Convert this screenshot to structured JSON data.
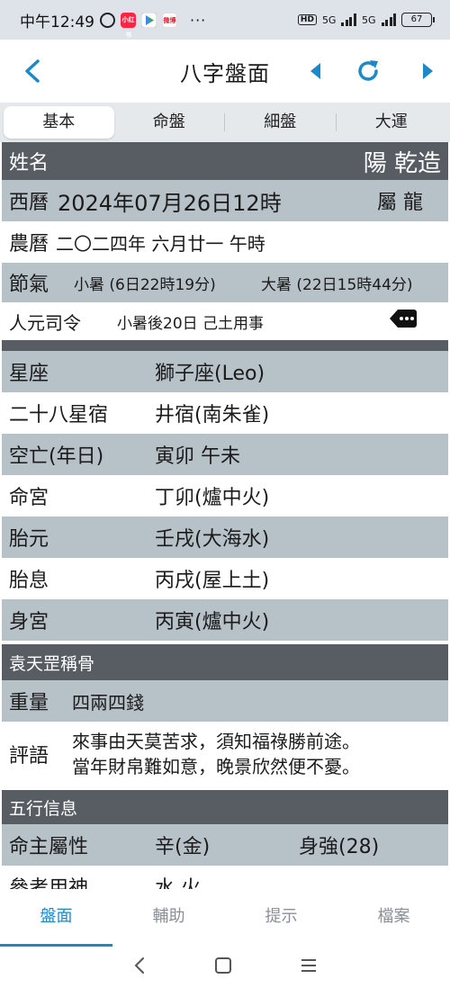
{
  "status_bar": {
    "time": "中午12:49",
    "more": "···",
    "hd": "HD",
    "network1": "5G",
    "network2": "5G",
    "battery": "67",
    "badge1": "小红书",
    "badge3": "微博"
  },
  "app_bar": {
    "title": "八字盤面"
  },
  "tabs": [
    "基本",
    "命盤",
    "細盤",
    "大運"
  ],
  "header": {
    "label": "姓名",
    "value": "陽 乾造"
  },
  "birth": {
    "solar_label": "西曆",
    "solar_value": "2024年07月26日12時",
    "zodiac": "屬 龍",
    "lunar_label": "農曆",
    "lunar_value": "二〇二四年 六月廿一 午時",
    "jieqi_label": "節氣",
    "jieqi_1": "小暑 (6日22時19分)",
    "jieqi_2": "大暑 (22日15時44分)",
    "siling_label": "人元司令",
    "siling_value": "小暑後20日 己土用事"
  },
  "info_rows": [
    {
      "label": "星座",
      "value": "獅子座(Leo)"
    },
    {
      "label": "二十八星宿",
      "value": "井宿(南朱雀)"
    },
    {
      "label": "空亡(年日)",
      "value": "寅卯 午未"
    },
    {
      "label": "命宮",
      "value": "丁卯(爐中火)"
    },
    {
      "label": "胎元",
      "value": "壬戌(大海水)"
    },
    {
      "label": "胎息",
      "value": "丙戌(屋上土)"
    },
    {
      "label": "身宮",
      "value": "丙寅(爐中火)"
    }
  ],
  "bone": {
    "section_title": "袁天罡稱骨",
    "weight_label": "重量",
    "weight_value": "四兩四錢",
    "comment_label": "評語",
    "comment_line1": "來事由天莫苦求，須知福祿勝前途。",
    "comment_line2": "當年財帛難如意，晚景欣然便不憂。"
  },
  "wuxing": {
    "section_title": "五行信息",
    "attr_label": "命主屬性",
    "attr_value": "辛(金)",
    "strength": "身強(28)",
    "partial_label": "參考用神",
    "partial_value": "水 火"
  },
  "bottom_nav": [
    "盤面",
    "輔助",
    "提示",
    "檔案"
  ],
  "colors": {
    "accent": "#1e88c8",
    "header_dark": "#575d62",
    "row_light": "#b7c1c8"
  }
}
